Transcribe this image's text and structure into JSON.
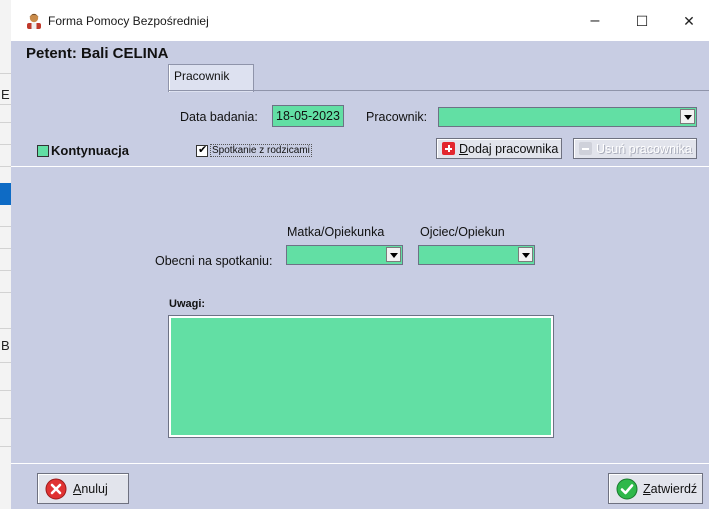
{
  "window": {
    "title": "Forma Pomocy Bezpośredniej",
    "minimize_glyph": "–",
    "maximize_glyph": "☐",
    "close_glyph": "✕"
  },
  "background_app": {
    "letters": [
      "E",
      "B"
    ]
  },
  "header": {
    "patient_title": "Petent: Bali CELINA"
  },
  "tabs": [
    {
      "label": "Pracownik",
      "active": true
    }
  ],
  "form": {
    "date_label": "Data badania:",
    "date_value": "18-05-2023",
    "worker_label": "Pracownik:",
    "worker_value": "",
    "continuation_label": "Kontynuacja",
    "meeting_checkbox": {
      "label": "Spotkanie z rodzicami",
      "checked": true,
      "mark": "✔"
    },
    "add_worker_button": {
      "prefix": "",
      "underlined": "D",
      "rest": "odaj pracownika"
    },
    "remove_worker_button": {
      "label": "Usuń pracownika",
      "enabled": false
    },
    "mother_label": "Matka/Opiekunka",
    "father_label": "Ojciec/Opiekun",
    "present_label": "Obecni na spotkaniu:",
    "mother_value": "",
    "father_value": "",
    "notes_label": "Uwagi:",
    "notes_value": ""
  },
  "footer": {
    "cancel_button": {
      "underlined": "A",
      "rest": "nuluj"
    },
    "confirm_button": {
      "underlined": "Z",
      "rest": "atwierdź"
    }
  },
  "colors": {
    "window_bg": "#c8cde3",
    "field_green": "#62dfa4",
    "cancel_red": "#e03232",
    "confirm_green": "#2eb84a"
  },
  "icons": {
    "app": "person-icon",
    "add": "plus-icon",
    "remove": "minus-icon",
    "cancel": "x-circle-icon",
    "confirm": "check-circle-icon",
    "dropdown": "chevron-down-icon"
  }
}
